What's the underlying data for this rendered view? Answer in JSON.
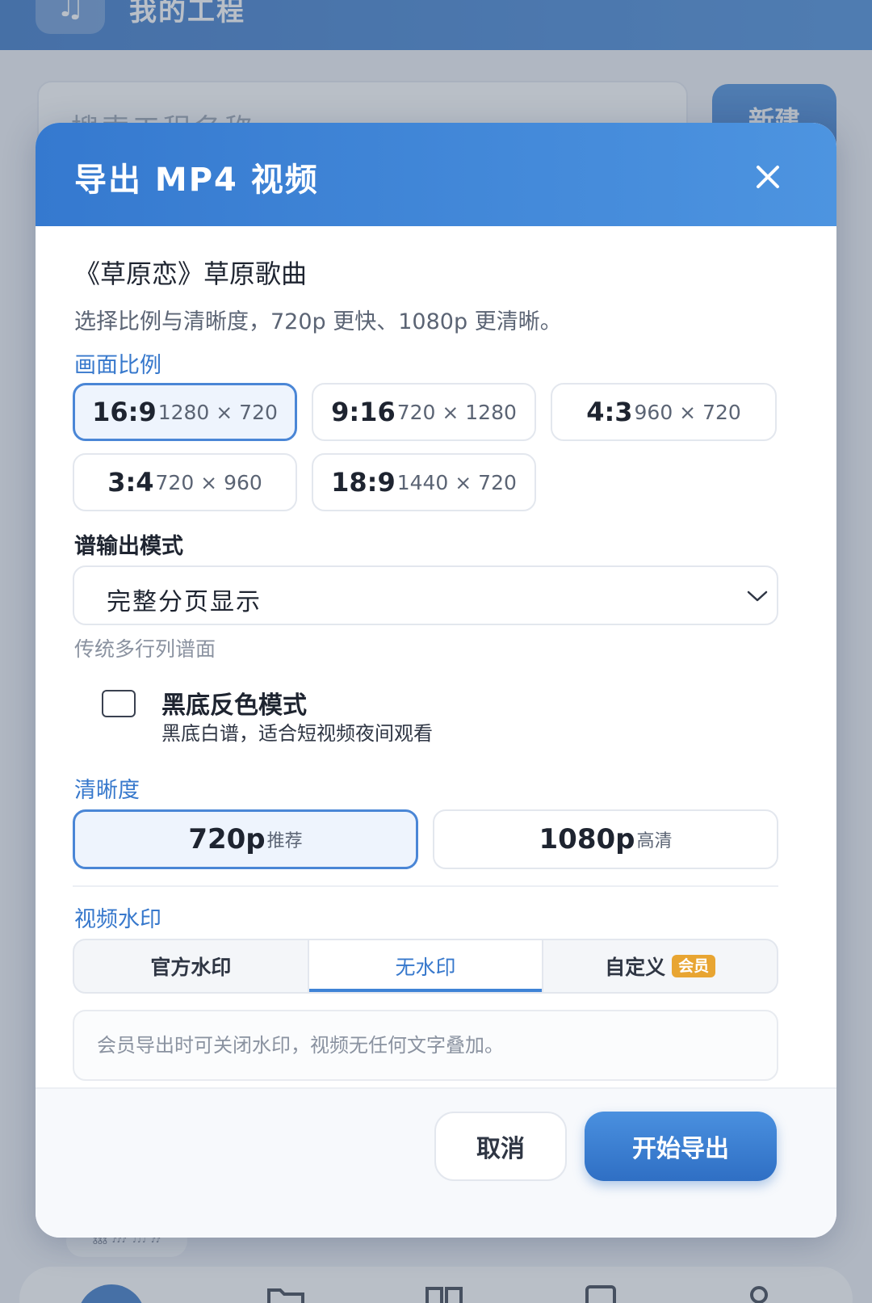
{
  "background": {
    "app_icon": "♫",
    "app_icon_name": "music-note-icon",
    "title": "我的工程",
    "search_placeholder": "搜索工程名称",
    "new_button_label": "新建",
    "thumbnail_text": "ᵹᵹᵹ ♪♪♪ ♩♩♩ ♪♪"
  },
  "dialog": {
    "title": "导出 MP4 视频",
    "close_icon": "close-icon",
    "song_name": "《草原恋》草原歌曲",
    "hint": "选择比例与清晰度，720p 更快、1080p 更清晰。",
    "aspect_ratio": {
      "label": "画面比例",
      "options": [
        {
          "ratio": "16:9",
          "resolution": "1280 × 720",
          "selected": true
        },
        {
          "ratio": "9:16",
          "resolution": "720 × 1280",
          "selected": false
        },
        {
          "ratio": "4:3",
          "resolution": "960 × 720",
          "selected": false
        },
        {
          "ratio": "3:4",
          "resolution": "720 × 960",
          "selected": false
        },
        {
          "ratio": "18:9",
          "resolution": "1440 × 720",
          "selected": false
        }
      ]
    },
    "score_mode": {
      "label": "谱输出模式",
      "selected": "完整分页显示",
      "description": "传统多行列谱面"
    },
    "dark_mode": {
      "title": "黑底反色模式",
      "description": "黑底白谱，适合短视频夜间观看",
      "checked": false
    },
    "quality": {
      "label": "清晰度",
      "options": [
        {
          "main": "720p",
          "sub": "推荐",
          "selected": true
        },
        {
          "main": "1080p",
          "sub": "高清",
          "selected": false
        }
      ]
    },
    "watermark": {
      "label": "视频水印",
      "options": [
        {
          "label": "官方水印",
          "active": false
        },
        {
          "label": "无水印",
          "active": true
        },
        {
          "label": "自定义",
          "badge": "会员",
          "active": false
        }
      ],
      "info": "会员导出时可关闭水印，视频无任何文字叠加。"
    },
    "footer": {
      "cancel_label": "取消",
      "export_label": "开始导出"
    }
  },
  "colors": {
    "accent": "#3778cc",
    "header_gradient_start": "#3579cf",
    "header_gradient_end": "#4d94e0",
    "vip_badge": "#e8a532"
  }
}
